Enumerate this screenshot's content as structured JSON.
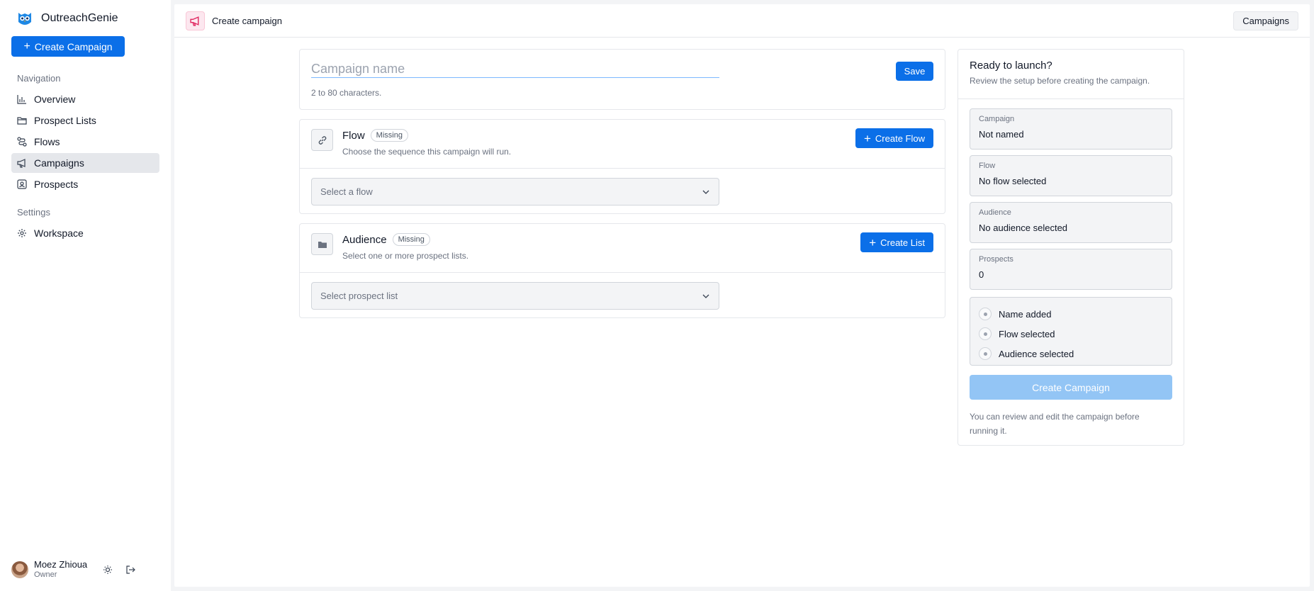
{
  "brand": {
    "name": "OutreachGenie",
    "logo_icon": "owl-logo-icon",
    "accent": "#0b6fe8"
  },
  "sidebar": {
    "create_label": "Create Campaign",
    "nav_label": "Navigation",
    "items": [
      {
        "label": "Overview",
        "icon": "bar-chart-icon"
      },
      {
        "label": "Prospect Lists",
        "icon": "folder-icon"
      },
      {
        "label": "Flows",
        "icon": "route-icon"
      },
      {
        "label": "Campaigns",
        "icon": "megaphone-icon",
        "active": true
      },
      {
        "label": "Prospects",
        "icon": "contact-icon"
      }
    ],
    "settings_label": "Settings",
    "settings_items": [
      {
        "label": "Workspace",
        "icon": "gear-icon"
      }
    ],
    "user": {
      "name": "Moez Zhioua",
      "role": "Owner"
    }
  },
  "topbar": {
    "title": "Create campaign",
    "right_button": "Campaigns"
  },
  "name_card": {
    "placeholder": "Campaign name",
    "value": "",
    "hint": "2 to 80 characters.",
    "save_label": "Save"
  },
  "flow_section": {
    "title": "Flow",
    "badge": "Missing",
    "description": "Choose the sequence this campaign will run.",
    "button_label": "Create Flow",
    "select_placeholder": "Select a flow"
  },
  "audience_section": {
    "title": "Audience",
    "badge": "Missing",
    "description": "Select one or more prospect lists.",
    "button_label": "Create List",
    "select_placeholder": "Select prospect list"
  },
  "summary": {
    "title": "Ready to launch?",
    "subtitle": "Review the setup before creating the campaign.",
    "fields": [
      {
        "label": "Campaign",
        "value": "Not named"
      },
      {
        "label": "Flow",
        "value": "No flow selected"
      },
      {
        "label": "Audience",
        "value": "No audience selected"
      },
      {
        "label": "Prospects",
        "value": "0"
      }
    ],
    "checklist": [
      {
        "label": "Name added",
        "done": false
      },
      {
        "label": "Flow selected",
        "done": false
      },
      {
        "label": "Audience selected",
        "done": false
      }
    ],
    "create_label": "Create Campaign",
    "note": "You can review and edit the campaign before running it."
  }
}
